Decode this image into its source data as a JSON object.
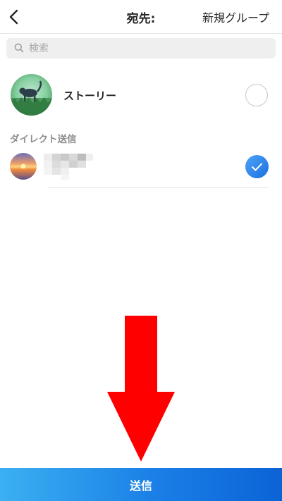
{
  "header": {
    "title": "宛先:",
    "new_group_label": "新規グループ",
    "back_icon": "chevron-left-icon"
  },
  "search": {
    "placeholder": "検索",
    "value": "",
    "icon": "search-icon"
  },
  "story_option": {
    "label": "ストーリー",
    "selected": false
  },
  "direct": {
    "section_label": "ダイレクト送信",
    "recipients": [
      {
        "name": "",
        "name_obscured": true,
        "selected": true
      }
    ]
  },
  "overlay": {
    "arrow_icon": "down-arrow-icon",
    "arrow_color": "#ff0000"
  },
  "footer": {
    "send_label": "送信"
  },
  "colors": {
    "accent": "#1a7fe6",
    "selected_radio": "#3897f0",
    "section_text": "#8e8e8e"
  }
}
